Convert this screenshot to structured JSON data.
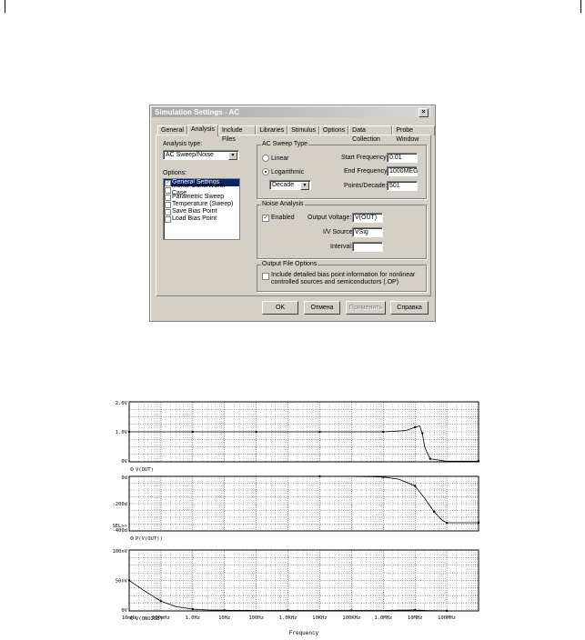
{
  "dialog": {
    "title": "Simulation Settings - AC",
    "close_glyph": "×",
    "tabs": [
      "General",
      "Analysis",
      "Include Files",
      "Libraries",
      "Stimulus",
      "Options",
      "Data Collection",
      "Probe Window"
    ],
    "active_tab": "Analysis",
    "analysis_type_label": "Analysis type:",
    "analysis_type_value": "AC Sweep/Noise",
    "options_label": "Options:",
    "options": [
      {
        "label": "General Settings",
        "selected": true,
        "checked": true
      },
      {
        "label": "Monte Carlo/Worst Case",
        "selected": false,
        "checked": false
      },
      {
        "label": "Parametric Sweep",
        "selected": false,
        "checked": false
      },
      {
        "label": "Temperature (Sweep)",
        "selected": false,
        "checked": false
      },
      {
        "label": "Save Bias Point",
        "selected": false,
        "checked": false
      },
      {
        "label": "Load Bias Point",
        "selected": false,
        "checked": false
      }
    ],
    "ac_sweep": {
      "title": "AC Sweep Type",
      "linear_label": "Linear",
      "log_label": "Logarithmic",
      "selected": "Logarithmic",
      "scale_value": "Decade",
      "start_label": "Start Frequency:",
      "start_value": "0.01",
      "end_label": "End Frequency:",
      "end_value": "1000MEG",
      "ppd_label": "Points/Decade:",
      "ppd_value": "501"
    },
    "noise": {
      "title": "Noise Analysis",
      "enabled_label": "Enabled",
      "enabled": true,
      "output_label": "Output Voltage:",
      "output_value": "V(OUT)",
      "source_label": "I/V Source:",
      "source_value": "VSig",
      "interval_label": "Interval:",
      "interval_value": ""
    },
    "output_file": {
      "title": "Output File Options",
      "text1": "Include detailed bias point information for nonlinear",
      "text2": "controlled sources and semiconductors (.OP)",
      "checked": false
    },
    "buttons": {
      "ok": "OK",
      "cancel": "Отмена",
      "apply": "Применить",
      "help": "Справка"
    }
  },
  "chart_data": [
    {
      "type": "line",
      "x_scale": "log",
      "xlim": [
        0.01,
        1000000000.0
      ],
      "ylim": [
        0,
        2.0
      ],
      "y_ticks": [
        "2.0V",
        "1.0V",
        "0V"
      ],
      "series": [
        {
          "name": "V(OUT)",
          "x": [
            0.01,
            0.1,
            1,
            10,
            100,
            1000,
            10000,
            100000,
            1000000,
            5000000,
            10000000,
            14000000,
            17000000,
            20000000,
            30000000,
            100000000,
            1000000000
          ],
          "y": [
            1.0,
            1.0,
            1.0,
            1.0,
            1.0,
            1.0,
            1.0,
            1.0,
            1.0,
            1.04,
            1.15,
            1.2,
            0.95,
            0.5,
            0.1,
            0.02,
            0.02
          ]
        }
      ]
    },
    {
      "type": "line",
      "x_scale": "log",
      "xlim": [
        0.01,
        1000000000.0
      ],
      "ylim": [
        -400,
        0
      ],
      "y_ticks": [
        "0d",
        "-200d",
        "-400d"
      ],
      "sel_marker": "SEL>>",
      "series": [
        {
          "name": "P(V(OUT))",
          "x": [
            10000,
            100000,
            1000000,
            3000000,
            10000000,
            20000000,
            40000000,
            70000000,
            100000000,
            200000000,
            1000000000
          ],
          "y": [
            0,
            0,
            -5,
            -20,
            -70,
            -160,
            -260,
            -320,
            -340,
            -340,
            -340
          ]
        }
      ]
    },
    {
      "type": "line",
      "x_scale": "log",
      "xlim": [
        0.01,
        1000000000.0
      ],
      "ylim": [
        0,
        100
      ],
      "y_ticks": [
        "100nV",
        "50nV",
        "0V"
      ],
      "series": [
        {
          "name": "V(ONOISE)",
          "x": [
            0.01,
            0.03,
            0.1,
            0.3,
            1,
            3,
            10,
            100,
            1000,
            10000,
            100000,
            1000000,
            10000000,
            30000000,
            100000000,
            1000000000
          ],
          "y": [
            50,
            33,
            16,
            7,
            3,
            1.5,
            1,
            0.8,
            0.8,
            0.8,
            0.8,
            0.8,
            1.5,
            0.5,
            0.2,
            0.2
          ]
        }
      ]
    }
  ],
  "chart_axis": {
    "x_ticks": [
      "10mHz",
      "100mHz",
      "1.0Hz",
      "10Hz",
      "100Hz",
      "1.0KHz",
      "10KHz",
      "100KHz",
      "1.0MHz",
      "10MHz",
      "100MHz"
    ],
    "xlabel": "Frequency"
  }
}
